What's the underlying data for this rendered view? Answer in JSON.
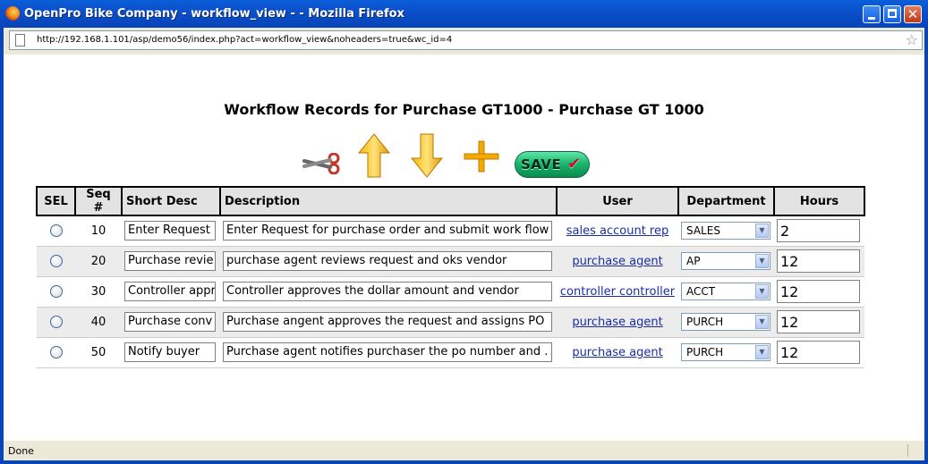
{
  "window": {
    "title": "OpenPro Bike Company - workflow_view - - Mozilla Firefox",
    "url": "http://192.168.1.101/asp/demo56/index.php?act=workflow_view&noheaders=true&wc_id=4",
    "status": "Done"
  },
  "page": {
    "heading": "Workflow Records for Purchase GT1000 - Purchase GT 1000",
    "save_label": "SAVE"
  },
  "table": {
    "headers": [
      "SEL",
      "Seq #",
      "Short Desc",
      "Description",
      "User",
      "Department",
      "Hours"
    ],
    "rows": [
      {
        "seq": "10",
        "short_desc": "Enter Request",
        "description": "Enter Request for purchase order and submit work flow",
        "user": "sales account rep",
        "department": "SALES",
        "hours": "2"
      },
      {
        "seq": "20",
        "short_desc": "Purchase revie",
        "description": "purchase agent reviews request and oks vendor",
        "user": "purchase agent",
        "department": "AP",
        "hours": "12"
      },
      {
        "seq": "30",
        "short_desc": "Controller appr",
        "description": "Controller approves the dollar amount and vendor",
        "user": "controller controller",
        "department": "ACCT",
        "hours": "12"
      },
      {
        "seq": "40",
        "short_desc": "Purchase conv",
        "description": "Purchase angent approves the request and assigns PO",
        "user": "purchase agent",
        "department": "PURCH",
        "hours": "12"
      },
      {
        "seq": "50",
        "short_desc": "Notify buyer",
        "description": "Purchase agent notifies purchaser the po number and .",
        "user": "purchase agent",
        "department": "PURCH",
        "hours": "12"
      }
    ]
  }
}
